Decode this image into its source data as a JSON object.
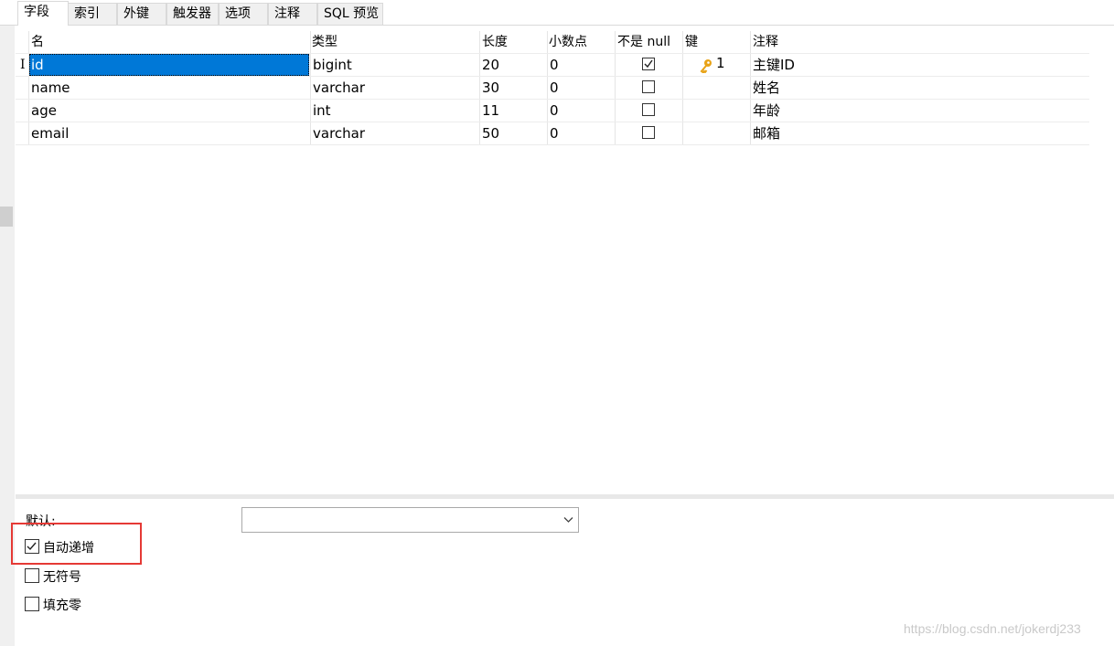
{
  "tabs": [
    "字段",
    "索引",
    "外键",
    "触发器",
    "选项",
    "注释",
    "SQL 预览"
  ],
  "columns": [
    "名",
    "类型",
    "长度",
    "小数点",
    "不是 null",
    "键",
    "注释"
  ],
  "rows": [
    {
      "name": "id",
      "type": "bigint",
      "length": "20",
      "decimals": "0",
      "not_null": true,
      "key": "1",
      "comment": "主键ID"
    },
    {
      "name": "name",
      "type": "varchar",
      "length": "30",
      "decimals": "0",
      "not_null": false,
      "key": "",
      "comment": "姓名"
    },
    {
      "name": "age",
      "type": "int",
      "length": "11",
      "decimals": "0",
      "not_null": false,
      "key": "",
      "comment": "年龄"
    },
    {
      "name": "email",
      "type": "varchar",
      "length": "50",
      "decimals": "0",
      "not_null": false,
      "key": "",
      "comment": "邮箱"
    }
  ],
  "properties": {
    "default_label": "默认:",
    "default_value": "",
    "auto_increment": {
      "label": "自动递增",
      "checked": true
    },
    "unsigned": {
      "label": "无符号",
      "checked": false
    },
    "zerofill": {
      "label": "填充零",
      "checked": false
    }
  },
  "watermark": "https://blog.csdn.net/jokerdj233",
  "colors": {
    "selection": "#0078d7",
    "highlight_box": "#e53935",
    "key_icon": "#e8a317"
  }
}
